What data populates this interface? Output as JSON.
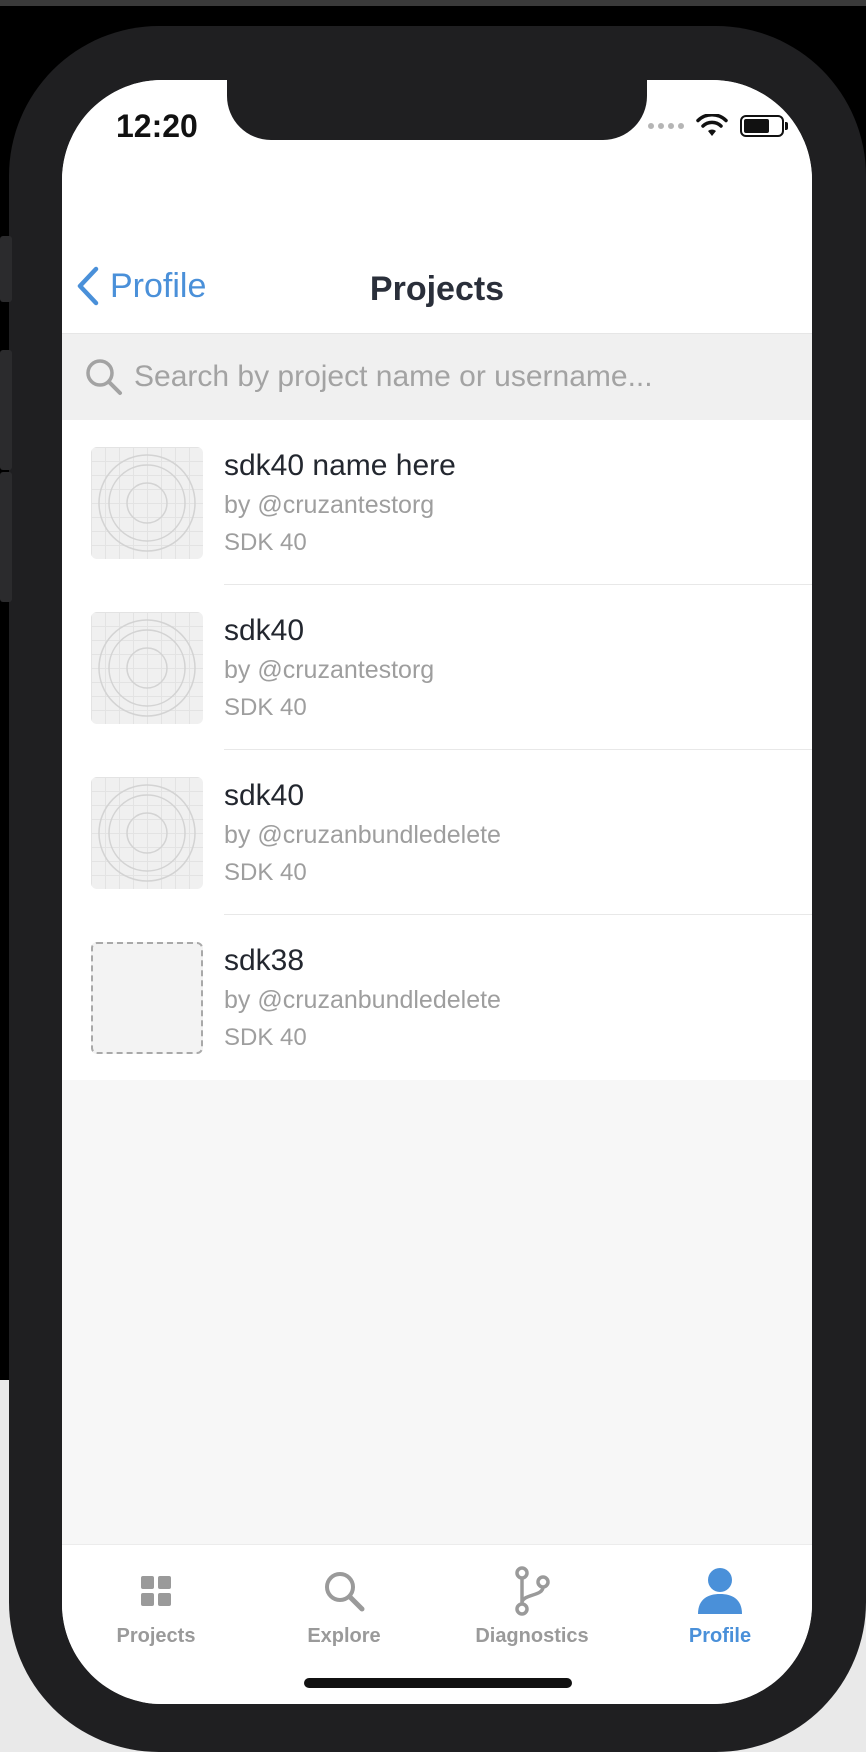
{
  "status_bar": {
    "time": "12:20"
  },
  "nav": {
    "back_label": "Profile",
    "title": "Projects"
  },
  "search": {
    "placeholder": "Search by project name or username..."
  },
  "projects": [
    {
      "name": "sdk40 name here",
      "owner": "by @cruzantestorg",
      "sdk": "SDK 40",
      "thumb": "default-icon"
    },
    {
      "name": "sdk40",
      "owner": "by @cruzantestorg",
      "sdk": "SDK 40",
      "thumb": "default-icon"
    },
    {
      "name": "sdk40",
      "owner": "by @cruzanbundledelete",
      "sdk": "SDK 40",
      "thumb": "default-icon"
    },
    {
      "name": "sdk38",
      "owner": "by @cruzanbundledelete",
      "sdk": "SDK 40",
      "thumb": "empty-placeholder"
    }
  ],
  "tabs": [
    {
      "label": "Projects",
      "icon": "grid-icon",
      "active": false
    },
    {
      "label": "Explore",
      "icon": "search-icon",
      "active": false
    },
    {
      "label": "Diagnostics",
      "icon": "branch-icon",
      "active": false
    },
    {
      "label": "Profile",
      "icon": "person-icon",
      "active": true
    }
  ],
  "colors": {
    "accent": "#4a90d9",
    "inactive_tab": "#9a9a9a",
    "title_text": "#2a2f3a",
    "secondary_text": "#9e9e9e"
  }
}
